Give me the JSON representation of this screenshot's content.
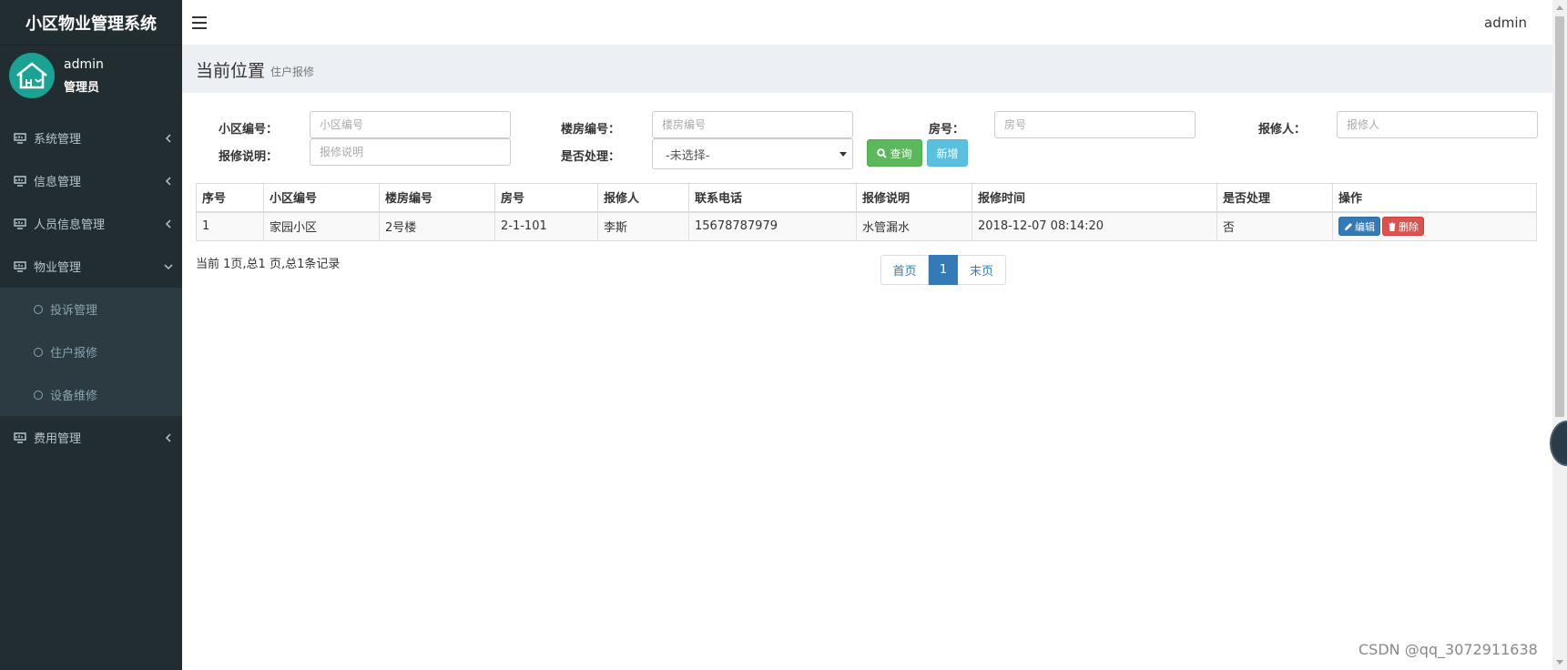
{
  "app": {
    "title": "小区物业管理系统"
  },
  "user_panel": {
    "name": "admin",
    "role": "管理员"
  },
  "sidebar": {
    "items": [
      {
        "label": "系统管理",
        "icon": "dashboard-icon",
        "expanded": false
      },
      {
        "label": "信息管理",
        "icon": "dashboard-icon",
        "expanded": false
      },
      {
        "label": "人员信息管理",
        "icon": "dashboard-icon",
        "expanded": false
      },
      {
        "label": "物业管理",
        "icon": "dashboard-icon",
        "expanded": true,
        "children": [
          {
            "label": "投诉管理",
            "icon": "circle-icon"
          },
          {
            "label": "住户报修",
            "icon": "circle-icon"
          },
          {
            "label": "设备维修",
            "icon": "circle-icon"
          }
        ]
      },
      {
        "label": "费用管理",
        "icon": "dashboard-icon",
        "expanded": false
      }
    ]
  },
  "header": {
    "user": "admin"
  },
  "content_header": {
    "title": "当前位置",
    "subtitle": "住户报修"
  },
  "search": {
    "community_label": "小区编号：",
    "community_placeholder": "小区编号",
    "building_label": "楼房编号：",
    "building_placeholder": "楼房编号",
    "room_label": "房号：",
    "room_placeholder": "房号",
    "reporter_label": "报修人：",
    "reporter_placeholder": "报修人",
    "desc_label": "报修说明：",
    "desc_placeholder": "报修说明",
    "handled_label": "是否处理：",
    "handled_value": "-未选择-",
    "query_button": "查询",
    "add_button": "新增"
  },
  "table": {
    "columns": [
      "序号",
      "小区编号",
      "楼房编号",
      "房号",
      "报修人",
      "联系电话",
      "报修说明",
      "报修时间",
      "是否处理",
      "操作"
    ],
    "rows": [
      [
        "1",
        "家园小区",
        "2号楼",
        "2-1-101",
        "李斯",
        "15678787979",
        "水管漏水",
        "2018-12-07 08:14:20",
        "否"
      ]
    ],
    "edit_label": "编辑",
    "delete_label": "删除"
  },
  "pagination": {
    "info": "当前 1页,总1 页,总1条记录",
    "first": "首页",
    "current": "1",
    "last": "末页"
  },
  "watermark": "CSDN @qq_3072911638",
  "colors": {
    "sidebar_bg": "#222d32",
    "submenu_bg": "#2c3b41",
    "avatar": "#1aa394",
    "primary": "#337ab7",
    "success": "#5cb85c",
    "info": "#5bc0de",
    "danger": "#d9534f"
  }
}
